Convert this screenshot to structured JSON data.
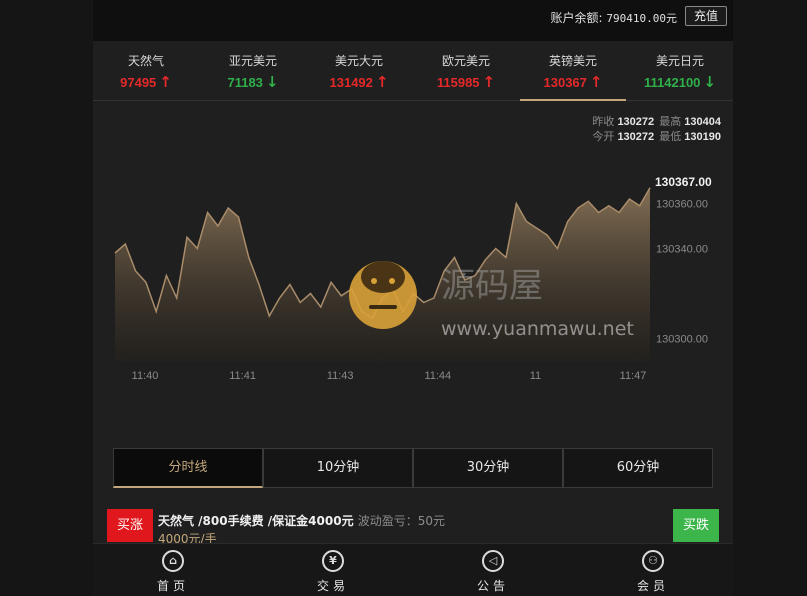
{
  "header": {
    "balance_label": "账户余额:",
    "balance_value": "790410.00元",
    "recharge_label": "充值"
  },
  "instruments": [
    {
      "name": "天然气",
      "price": "97495",
      "direction": "up"
    },
    {
      "name": "亚元美元",
      "price": "71183",
      "direction": "down"
    },
    {
      "name": "美元大元",
      "price": "131492",
      "direction": "up"
    },
    {
      "name": "欧元美元",
      "price": "115985",
      "direction": "up"
    },
    {
      "name": "英镑美元",
      "price": "130367",
      "direction": "up",
      "active": true
    },
    {
      "name": "美元日元",
      "price": "11142100",
      "direction": "down"
    }
  ],
  "stats": {
    "prev_close_label": "昨收",
    "prev_close": "130272",
    "high_label": "最高",
    "high": "130404",
    "open_label": "今开",
    "open": "130272",
    "low_label": "最低",
    "low": "130190"
  },
  "chart_data": {
    "type": "area",
    "current_price_label": "130367.00",
    "x_ticks": [
      "11:40",
      "11:41",
      "11:43",
      "11:44",
      "11",
      "11:47"
    ],
    "y_ticks": [
      "130360.00",
      "130340.00",
      "130300.00"
    ],
    "ylim": [
      130290,
      130370
    ],
    "values": [
      130338,
      130342,
      130330,
      130325,
      130312,
      130328,
      130318,
      130345,
      130340,
      130356,
      130350,
      130358,
      130354,
      130336,
      130324,
      130310,
      130318,
      130324,
      130316,
      130320,
      130314,
      130325,
      130319,
      130322,
      130312,
      130309,
      130318,
      130322,
      130312,
      130320,
      130316,
      130318,
      130330,
      130336,
      130326,
      130328,
      130335,
      130340,
      130336,
      130360,
      130352,
      130349,
      130346,
      130340,
      130352,
      130358,
      130361,
      130356,
      130359,
      130356,
      130362,
      130359,
      130367
    ],
    "colors": {
      "line": "#a98c6a",
      "fill": "#8a7458",
      "grid_text": "#8a8a8a"
    }
  },
  "periods": [
    {
      "label": "分时线",
      "active": true
    },
    {
      "label": "10分钟"
    },
    {
      "label": "30分钟"
    },
    {
      "label": "60分钟"
    }
  ],
  "order": {
    "buy_up_label": "买涨",
    "buy_down_label": "买跌",
    "product": "天然气 /800手续费 /保证金4000元",
    "fluctuation": "波动盈亏：50元",
    "price_per_lot": "4000元/手"
  },
  "nav": [
    {
      "label": "首页",
      "icon": "home-icon",
      "glyph": "⌂"
    },
    {
      "label": "交易",
      "icon": "yen-icon",
      "glyph": "¥"
    },
    {
      "label": "公告",
      "icon": "speaker-icon",
      "glyph": "◁"
    },
    {
      "label": "会员",
      "icon": "user-icon",
      "glyph": "⚇"
    }
  ],
  "watermark": {
    "text_cn": "源码屋",
    "url": "www.yuanmawu.net"
  }
}
